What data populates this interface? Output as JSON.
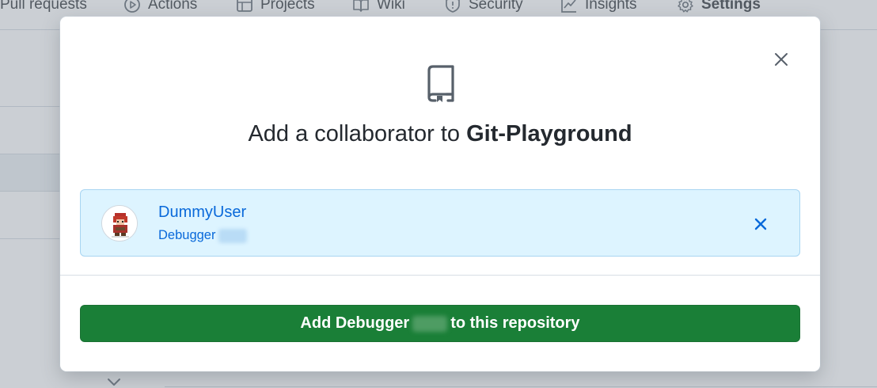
{
  "repo_nav": {
    "items": [
      {
        "label": "Pull requests",
        "icon": "pull-request-icon"
      },
      {
        "label": "Actions",
        "icon": "play-icon"
      },
      {
        "label": "Projects",
        "icon": "table-icon"
      },
      {
        "label": "Wiki",
        "icon": "book-icon"
      },
      {
        "label": "Security",
        "icon": "shield-icon"
      },
      {
        "label": "Insights",
        "icon": "graph-icon"
      },
      {
        "label": "Settings",
        "icon": "gear-icon"
      }
    ]
  },
  "modal": {
    "title_prefix": "Add a collaborator to ",
    "repo_name": "Git-Playground",
    "repo_icon": "repo-icon",
    "close_icon": "close-icon",
    "selected_user": {
      "login": "DummyUser",
      "name": "Debugger",
      "remove_icon": "close-icon"
    },
    "add_button": {
      "prefix": "Add Debugger",
      "suffix": "to this repository"
    }
  },
  "colors": {
    "primary_button": "#1a7f37",
    "selected_bg": "#ddf4ff",
    "link": "#0969da"
  }
}
